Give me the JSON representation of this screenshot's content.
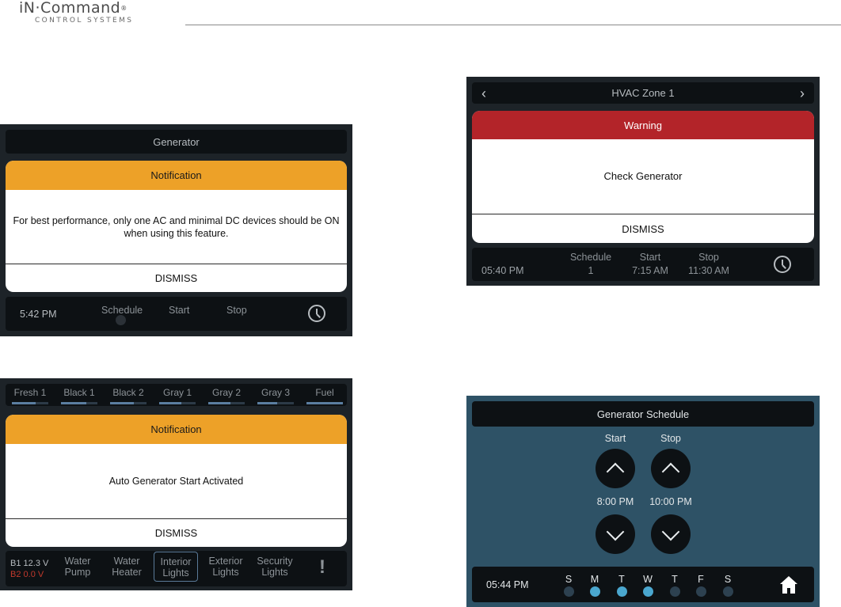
{
  "brand": {
    "name": "iN·Command",
    "reg": "®",
    "tagline": "CONTROL SYSTEMS"
  },
  "generator_screen": {
    "title": "Generator",
    "notification": {
      "header": "Notification",
      "message": "For best performance, only one AC and minimal DC devices should be ON when using this feature.",
      "dismiss": "DISMISS"
    },
    "footer": {
      "time": "5:42 PM",
      "schedule_label": "Schedule",
      "start_label": "Start",
      "stop_label": "Stop",
      "icon": "clock-icon"
    },
    "colors": {
      "header": "#eda128"
    }
  },
  "hvac_screen": {
    "title": "HVAC Zone 1",
    "prev_icon": "‹",
    "next_icon": "›",
    "warning": {
      "header": "Warning",
      "message": "Check Generator",
      "dismiss": "DISMISS"
    },
    "footer": {
      "time": "05:40 PM",
      "schedule_label": "Schedule",
      "schedule_value": "1",
      "start_label": "Start",
      "start_value": "7:15 AM",
      "stop_label": "Stop",
      "stop_value": "11:30 AM",
      "icon": "clock-icon"
    },
    "colors": {
      "header": "#b32429"
    }
  },
  "tanks_screen": {
    "tanks": [
      {
        "name": "Fresh 1",
        "level": 0.65
      },
      {
        "name": "Black 1",
        "level": 0.7
      },
      {
        "name": "Black 2",
        "level": 0.65
      },
      {
        "name": "Gray 1",
        "level": 0.6
      },
      {
        "name": "Gray 2",
        "level": 0.6
      },
      {
        "name": "Gray 3",
        "level": 0.55
      },
      {
        "name": "Fuel",
        "level": 1.0
      }
    ],
    "notification": {
      "header": "Notification",
      "message": "Auto Generator Start Activated",
      "dismiss": "DISMISS"
    },
    "battery": {
      "b1_label": "B1",
      "b1_value": "12.3 V",
      "b2_label": "B2",
      "b2_value": "0.0 V"
    },
    "controls": [
      {
        "line1": "Water",
        "line2": "Pump"
      },
      {
        "line1": "Water",
        "line2": "Heater"
      },
      {
        "line1": "Interior",
        "line2": "Lights"
      },
      {
        "line1": "Exterior",
        "line2": "Lights"
      },
      {
        "line1": "Security",
        "line2": "Lights"
      }
    ],
    "alert_icon": "!"
  },
  "schedule_screen": {
    "title": "Generator Schedule",
    "start_label": "Start",
    "stop_label": "Stop",
    "start_time": "8:00 PM",
    "stop_time": "10:00 PM",
    "footer": {
      "time": "05:44 PM"
    },
    "days": [
      {
        "letter": "S",
        "on": false
      },
      {
        "letter": "M",
        "on": true
      },
      {
        "letter": "T",
        "on": true
      },
      {
        "letter": "W",
        "on": true
      },
      {
        "letter": "T",
        "on": false
      },
      {
        "letter": "F",
        "on": false
      },
      {
        "letter": "S",
        "on": false
      }
    ],
    "home_icon": "home-icon",
    "colors": {
      "background": "#2e5266",
      "day_on": "#4aa7cf"
    }
  }
}
